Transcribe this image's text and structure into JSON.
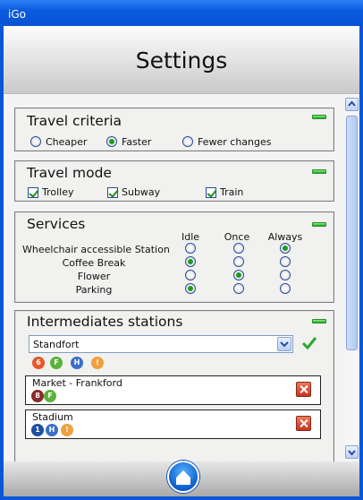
{
  "window": {
    "title": "iGo"
  },
  "header": {
    "title": "Settings"
  },
  "colors": {
    "accent": "#0b56d6",
    "checked": "#1f9a1f",
    "delete": "#d0412a"
  },
  "travel_criteria": {
    "title": "Travel criteria",
    "options": [
      {
        "label": "Cheaper",
        "selected": false
      },
      {
        "label": "Faster",
        "selected": true
      },
      {
        "label": "Fewer changes",
        "selected": false
      }
    ]
  },
  "travel_mode": {
    "title": "Travel mode",
    "options": [
      {
        "label": "Trolley",
        "checked": true
      },
      {
        "label": "Subway",
        "checked": true
      },
      {
        "label": "Train",
        "checked": true
      }
    ]
  },
  "services": {
    "title": "Services",
    "columns": [
      "Idle",
      "Once",
      "Always"
    ],
    "rows": [
      {
        "label": "Wheelchair accessible Station",
        "selected": "Always"
      },
      {
        "label": "Coffee Break",
        "selected": "Idle"
      },
      {
        "label": "Flower",
        "selected": "Once"
      },
      {
        "label": "Parking",
        "selected": "Idle"
      }
    ]
  },
  "intermediates": {
    "title": "Intermediates stations",
    "selected_value": "Standfort",
    "stations": [
      {
        "name": "Standfort",
        "lines": [
          "6",
          "F",
          "H",
          "!"
        ]
      },
      {
        "name": "Market - Frankford",
        "lines": [
          "8",
          "F"
        ]
      },
      {
        "name": "Stadium",
        "lines": [
          "1",
          "H",
          "!"
        ]
      }
    ]
  },
  "icons": {
    "dropdown": "chevron-down-icon",
    "confirm": "checkmark-icon",
    "remove": "close-icon",
    "home": "home-icon"
  }
}
